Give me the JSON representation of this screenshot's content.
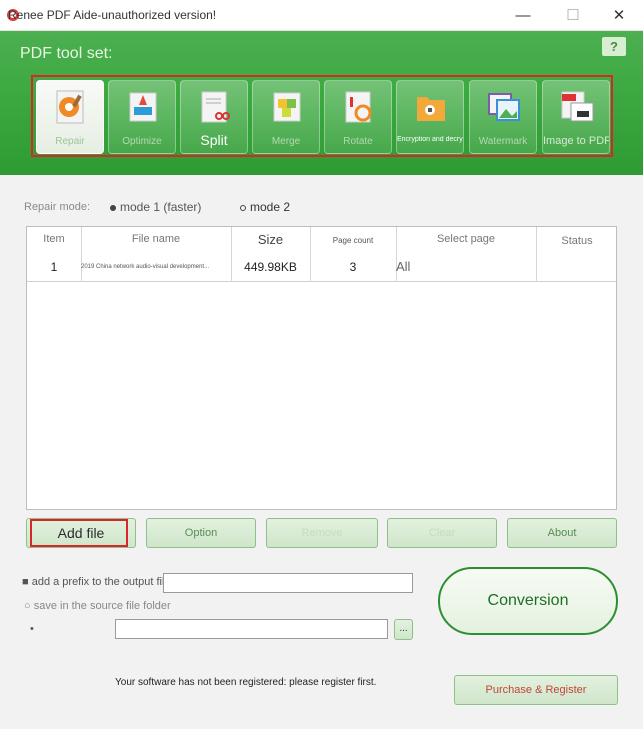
{
  "window": {
    "title": "Renee PDF Aide-unauthorized version!",
    "minimize_glyph": "—",
    "maximize_glyph": "☐",
    "close_glyph": "✕"
  },
  "header": {
    "toolset_title": "PDF tool set:",
    "help_glyph": "?",
    "tools": [
      {
        "label": "Repair",
        "icon": "repair-gear-icon"
      },
      {
        "label": "Optimize",
        "icon": "rocket-icon"
      },
      {
        "label": "Split",
        "icon": "scissors-icon"
      },
      {
        "label": "Merge",
        "icon": "puzzle-icon"
      },
      {
        "label": "Rotate",
        "icon": "rotate-icon"
      },
      {
        "label": "Encryption and decryption",
        "icon": "lock-folder-icon"
      },
      {
        "label": "Watermark",
        "icon": "picture-icon"
      },
      {
        "label": "Image to PDF",
        "icon": "jpg-to-pdf-icon"
      }
    ]
  },
  "repair": {
    "mode_label": "Repair mode:",
    "mode1": "mode 1 (faster)",
    "mode2": "mode 2"
  },
  "table": {
    "columns": [
      "Item",
      "File name",
      "Size",
      "Page count",
      "Select page",
      "Status"
    ],
    "rows": [
      {
        "item": "1",
        "file_name": "2019 China network audio-visual development...",
        "size": "449.98KB",
        "page_count": "3",
        "select_page": "All",
        "status": ""
      }
    ]
  },
  "buttons": {
    "add_file": "Add file",
    "option": "Option",
    "remove": "Remove",
    "clear": "Clear",
    "about": "About",
    "browse": "...",
    "conversion": "Conversion",
    "purchase": "Purchase & Register"
  },
  "output": {
    "prefix_label": "add a prefix to the output file",
    "prefix_value": "",
    "source_folder_label": "save in the source file folder",
    "path_value": ""
  },
  "notice": "Your software has not been registered: please register first.",
  "colors": {
    "header_green": "#3aa83e",
    "highlight_red": "#d9262a",
    "conversion_green": "#2b8f30",
    "purchase_red": "#c0453c"
  }
}
